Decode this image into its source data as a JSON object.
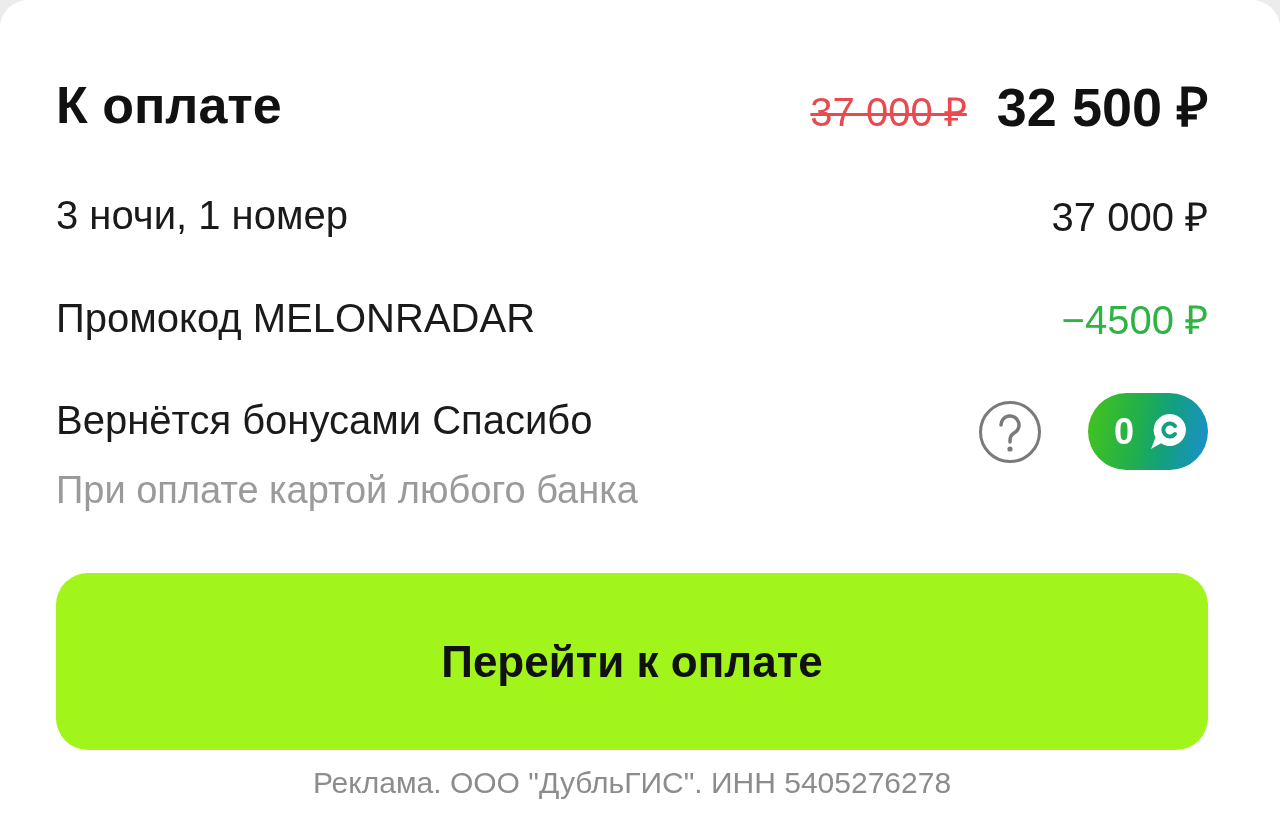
{
  "header": {
    "title": "К оплате",
    "old_price": "37 000 ₽",
    "price": "32 500 ₽"
  },
  "lines": [
    {
      "kind": "plain",
      "label": "3 ночи, 1 номер",
      "amount": "37 000 ₽"
    },
    {
      "kind": "discount",
      "label": "Промокод MELONRADAR",
      "amount": "−4500 ₽"
    }
  ],
  "bonus": {
    "label": "Вернётся бонусами Спасибо",
    "note": "При оплате картой любого банка",
    "points": "0"
  },
  "pay_button": {
    "label": "Перейти к оплате"
  },
  "footer": "Реклама. ООО \"ДубльГИС\". ИНН 5405276278"
}
